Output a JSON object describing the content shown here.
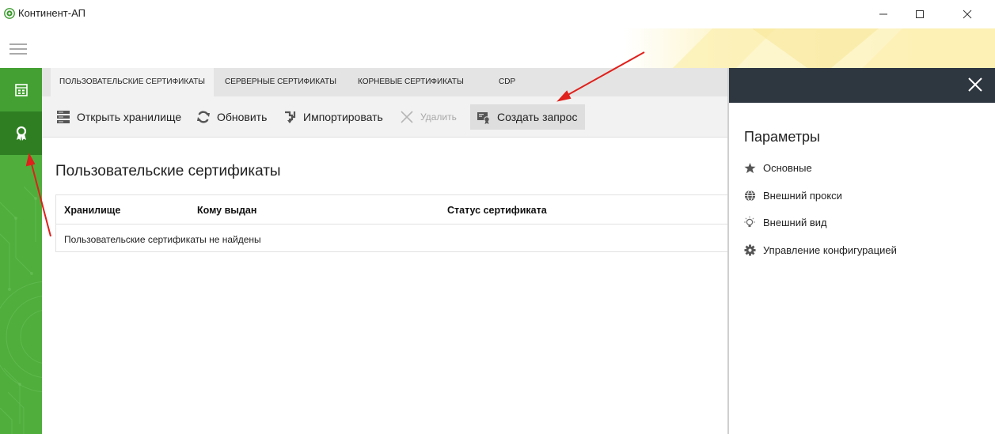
{
  "window": {
    "title": "Континент-АП",
    "icon": "continent-logo-icon"
  },
  "colors": {
    "sidebar_green": "#4fae3c",
    "sidebar_active": "#2f7f22",
    "panel_header": "#2e3640",
    "banner_yellow": "#fdf3c0",
    "arrow_red": "#e0201b"
  },
  "tabs": [
    {
      "label": "ПОЛЬЗОВАТЕЛЬСКИЕ СЕРТИФИКАТЫ",
      "active": true
    },
    {
      "label": "СЕРВЕРНЫЕ СЕРТИФИКАТЫ",
      "active": false
    },
    {
      "label": "КОРНЕВЫЕ СЕРТИФИКАТЫ",
      "active": false
    },
    {
      "label": "CDP",
      "active": false
    }
  ],
  "toolbar": {
    "open_store": "Открыть хранилище",
    "refresh": "Обновить",
    "import": "Импортировать",
    "delete": "Удалить",
    "create_request": "Создать запрос"
  },
  "content": {
    "title": "Пользовательские сертификаты",
    "columns": [
      "Хранилище",
      "Кому выдан",
      "Статус сертификата"
    ],
    "empty_message": "Пользовательские сертификаты не найдены"
  },
  "panel": {
    "title": "Параметры",
    "items": [
      {
        "label": "Основные",
        "icon": "star-icon"
      },
      {
        "label": "Внешний прокси",
        "icon": "globe-icon"
      },
      {
        "label": "Внешний вид",
        "icon": "lightbulb-icon"
      },
      {
        "label": "Управление конфигурацией",
        "icon": "gear-icon"
      }
    ]
  }
}
